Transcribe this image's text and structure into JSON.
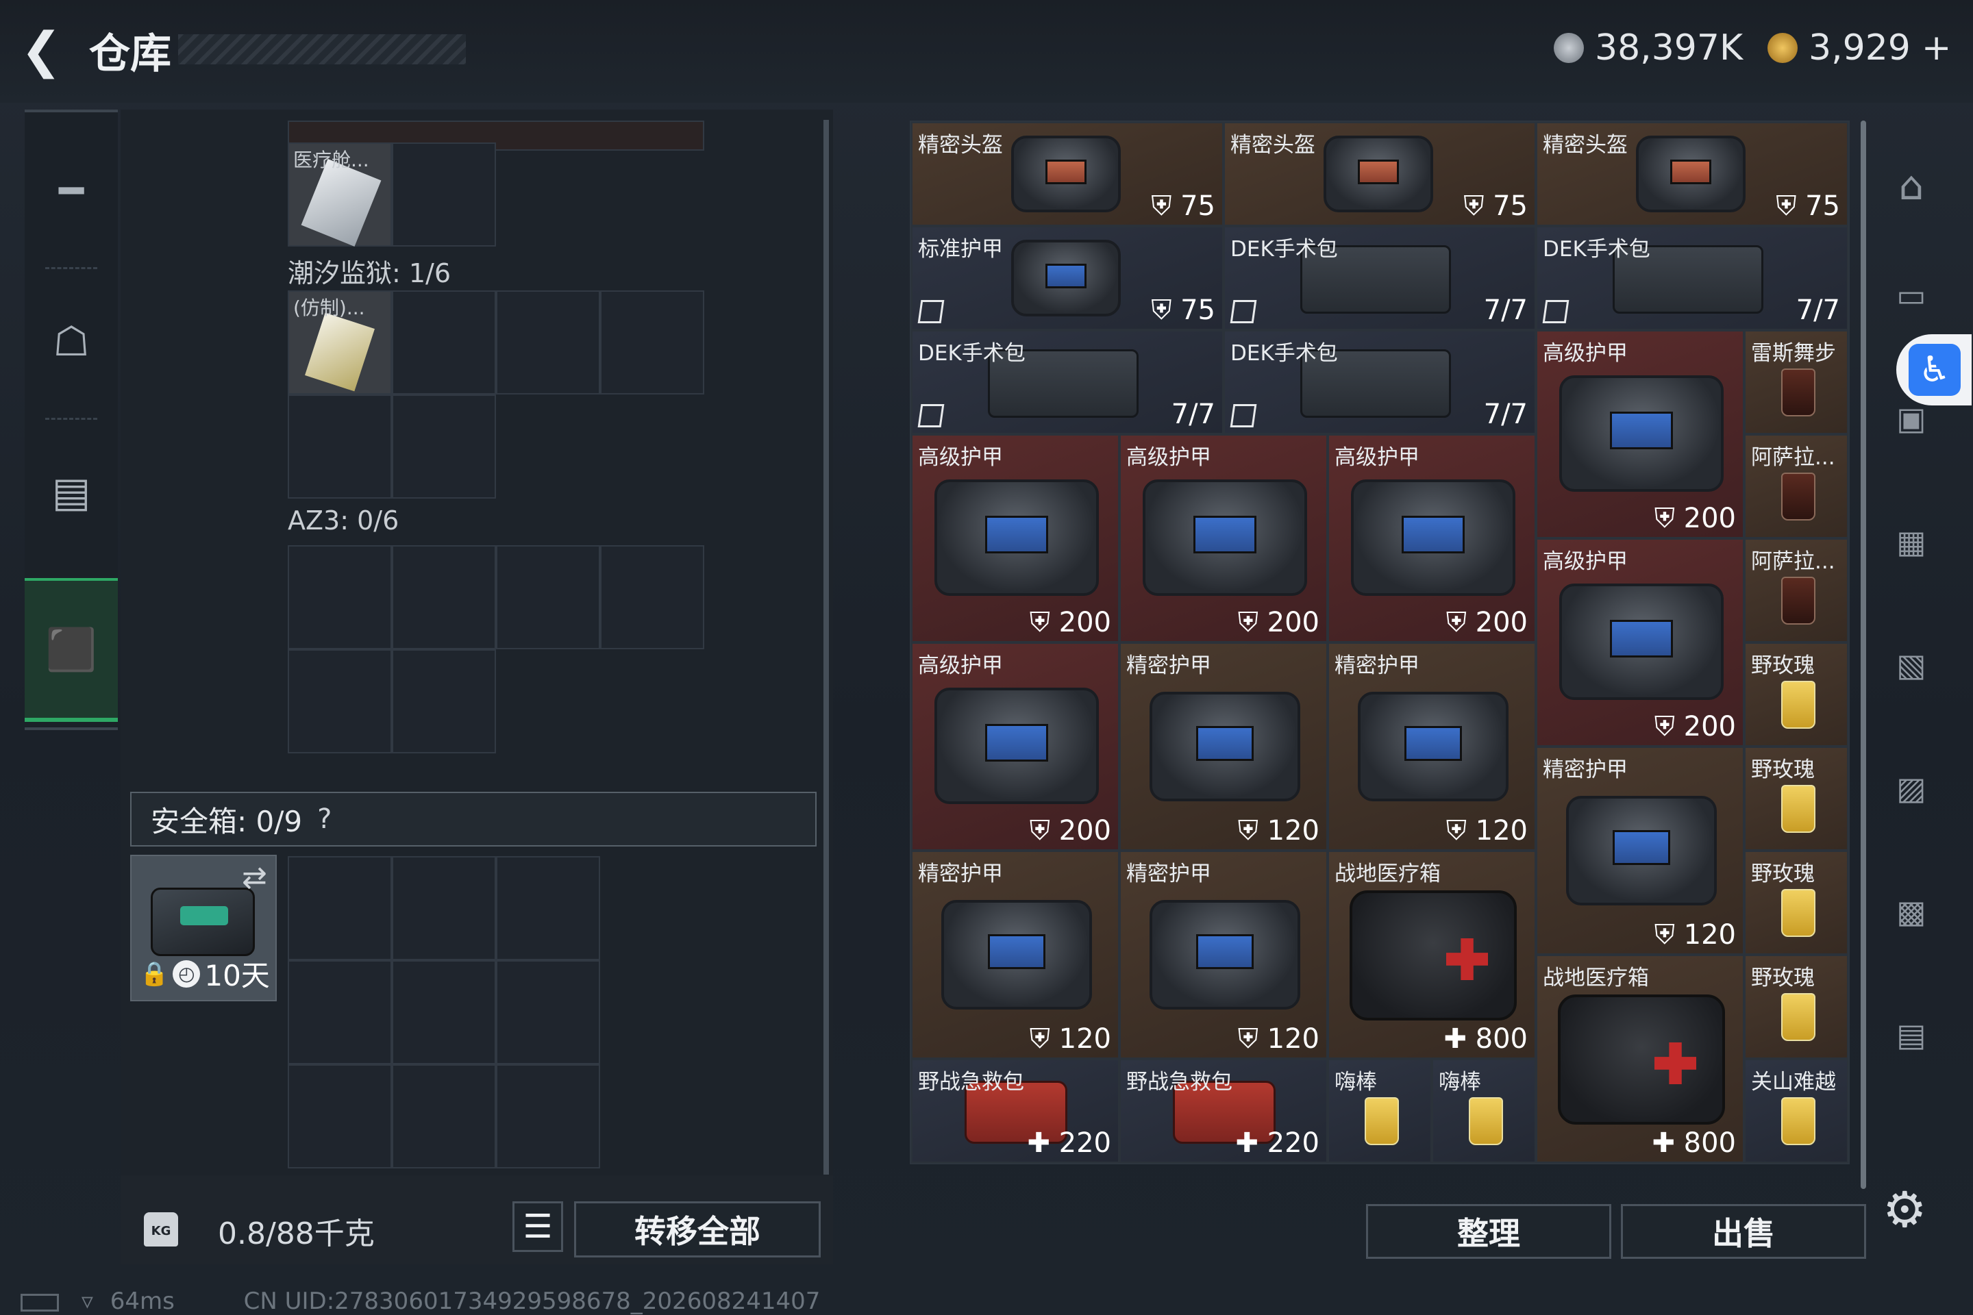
{
  "header": {
    "title": "仓库",
    "currency1": "38,397K",
    "currency2": "3,929",
    "currency2_add": "+"
  },
  "left": {
    "med_item_label": "医疗舱...",
    "section1": "潮汐监狱: 1/6",
    "copy_item_label": "(仿制)...",
    "section2": "AZ3: 0/6",
    "safebox": "安全箱: 0/9",
    "safebox_help": "?",
    "safe_item_time": "10天",
    "weight": "0.8/88千克",
    "transfer_all": "转移全部"
  },
  "stash": {
    "items": [
      {
        "name": "精密头盔",
        "value": "75"
      },
      {
        "name": "精密头盔",
        "value": "75"
      },
      {
        "name": "精密头盔",
        "value": "75"
      },
      {
        "name": "标准护甲",
        "value": "75"
      },
      {
        "name": "DEK手术包",
        "value": "7/7"
      },
      {
        "name": "DEK手术包",
        "value": "7/7"
      },
      {
        "name": "DEK手术包",
        "value": "7/7"
      },
      {
        "name": "DEK手术包",
        "value": "7/7"
      },
      {
        "name": "高级护甲",
        "value": "200"
      },
      {
        "name": "雷斯舞步",
        "value": ""
      },
      {
        "name": "高级护甲",
        "value": "200"
      },
      {
        "name": "高级护甲",
        "value": "200"
      },
      {
        "name": "高级护甲",
        "value": "200"
      },
      {
        "name": "阿萨拉...",
        "value": ""
      },
      {
        "name": "高级护甲",
        "value": "200"
      },
      {
        "name": "阿萨拉...",
        "value": ""
      },
      {
        "name": "高级护甲",
        "value": "200"
      },
      {
        "name": "精密护甲",
        "value": "120"
      },
      {
        "name": "精密护甲",
        "value": "120"
      },
      {
        "name": "野玫瑰",
        "value": ""
      },
      {
        "name": "精密护甲",
        "value": "120"
      },
      {
        "name": "野玫瑰",
        "value": ""
      },
      {
        "name": "精密护甲",
        "value": "120"
      },
      {
        "name": "精密护甲",
        "value": "120"
      },
      {
        "name": "战地医疗箱",
        "value": "800"
      },
      {
        "name": "野玫瑰",
        "value": ""
      },
      {
        "name": "战地医疗箱",
        "value": "800"
      },
      {
        "name": "野玫瑰",
        "value": ""
      },
      {
        "name": "野战急救包",
        "value": "220"
      },
      {
        "name": "野战急救包",
        "value": "220"
      },
      {
        "name": "嗨棒",
        "value": ""
      },
      {
        "name": "嗨棒",
        "value": ""
      },
      {
        "name": "关山难越",
        "value": ""
      }
    ],
    "sort": "整理",
    "sell": "出售"
  },
  "status": {
    "ping": "64ms",
    "uid": "CN UID:27830601734929598678_202608241407"
  },
  "icons": [
    "back-icon",
    "coin-icon",
    "gold-coin-icon",
    "gun-icon",
    "backpack-icon",
    "vest-icon",
    "case-icon",
    "lock-icon",
    "list-icon",
    "shield-icon",
    "cross-icon",
    "gear-icon",
    "accessibility-icon",
    "wifi-icon",
    "battery-icon"
  ],
  "colors": {
    "accent_green": "#2ea865",
    "accessibility_blue": "#2f7df6"
  }
}
